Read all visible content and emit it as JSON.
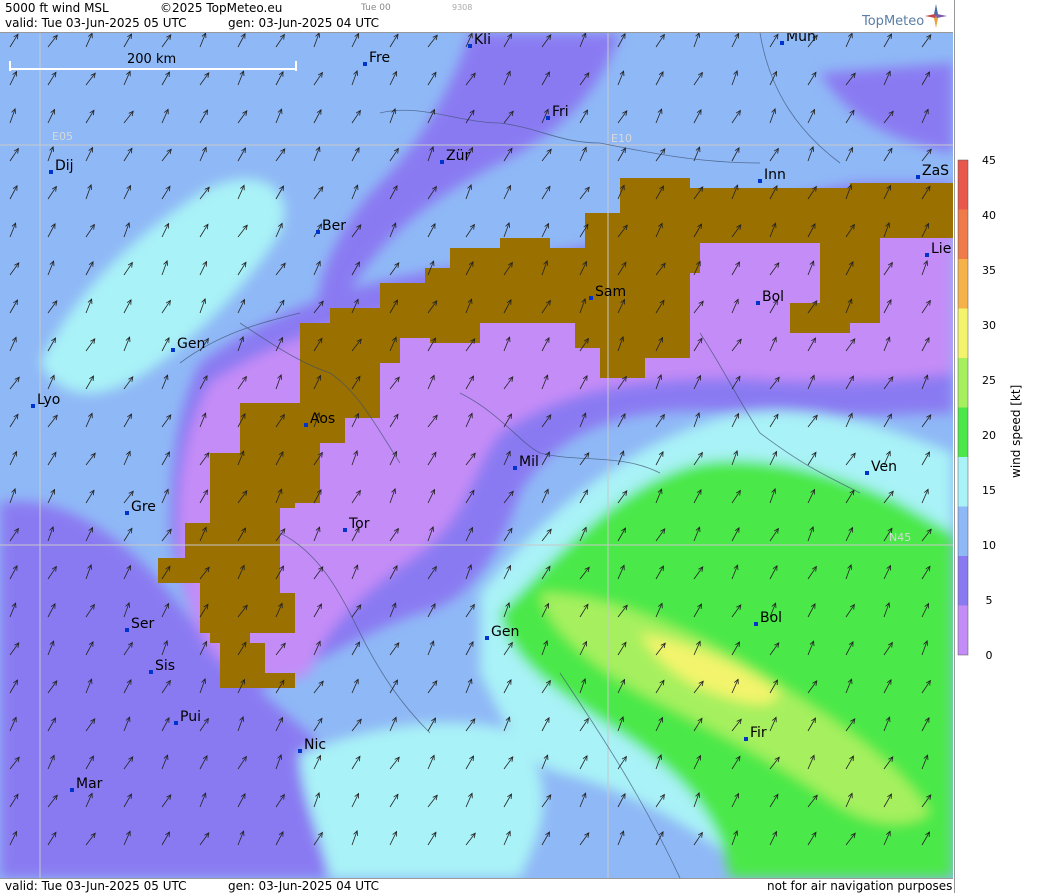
{
  "header": {
    "product": "5000 ft wind MSL",
    "copyright": "©2025 TopMeteo.eu",
    "run": "Tue 00",
    "code": "9308",
    "valid": "valid:  Tue   03-Jun-2025  05 UTC",
    "gen": "gen: 03-Jun-2025 04 UTC",
    "logo": "TopMeteo"
  },
  "footer": {
    "valid": "valid:  Tue   03-Jun-2025  05 UTC",
    "gen": "gen: 03-Jun-2025 04 UTC",
    "notice": "not for air navigation purposes"
  },
  "scale": {
    "label": "200 km"
  },
  "graticule": {
    "labels": [
      "E05",
      "E10",
      "N45"
    ]
  },
  "legend": {
    "title": "wind speed [kt]",
    "ticks": [
      "0",
      "5",
      "10",
      "15",
      "20",
      "25",
      "30",
      "35",
      "40",
      "45"
    ],
    "colors": [
      "#c48cf7",
      "#8a7af2",
      "#8fb8f6",
      "#a9f2f7",
      "#4ce84a",
      "#a6f05e",
      "#f3f46c",
      "#f5b24a",
      "#ef7a4a",
      "#e8584c"
    ]
  },
  "terrain_color": "#9a7000",
  "cities": [
    {
      "name": "Kli"
    },
    {
      "name": "Mun"
    },
    {
      "name": "Fre"
    },
    {
      "name": "Fri"
    },
    {
      "name": "Dij"
    },
    {
      "name": "Zür"
    },
    {
      "name": "Inn"
    },
    {
      "name": "ZaS"
    },
    {
      "name": "Ber"
    },
    {
      "name": "Lie"
    },
    {
      "name": "Sam"
    },
    {
      "name": "Bol"
    },
    {
      "name": "Gen"
    },
    {
      "name": "Lyo"
    },
    {
      "name": "Aos"
    },
    {
      "name": "Mil"
    },
    {
      "name": "Ven"
    },
    {
      "name": "Gre"
    },
    {
      "name": "Tor"
    },
    {
      "name": "Ser"
    },
    {
      "name": "Gen"
    },
    {
      "name": "Bol"
    },
    {
      "name": "Sis"
    },
    {
      "name": "Pui"
    },
    {
      "name": "Fir"
    },
    {
      "name": "Nic"
    },
    {
      "name": "Mar"
    }
  ]
}
